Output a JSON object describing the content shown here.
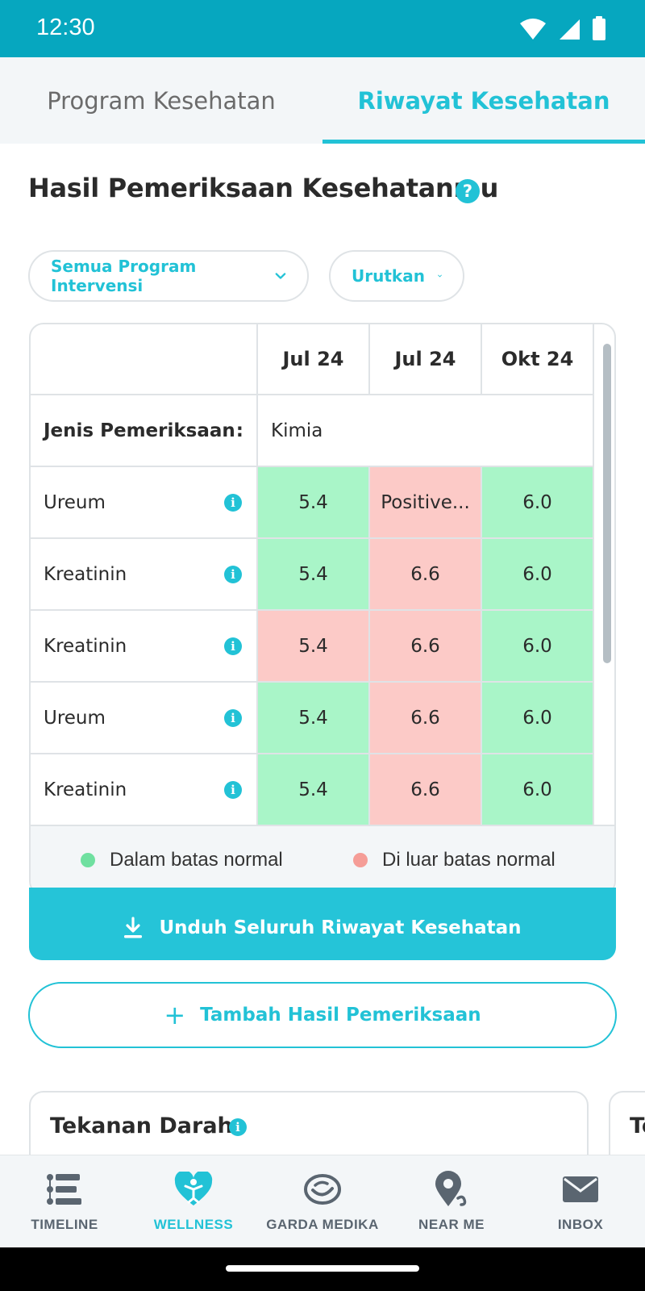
{
  "status_bar": {
    "time": "12:30"
  },
  "tabs": [
    {
      "label": "Program Kesehatan",
      "active": false
    },
    {
      "label": "Riwayat Kesehatan",
      "active": true
    }
  ],
  "section": {
    "title": "Hasil Pemeriksaan Kesehatanmu",
    "help_icon": "?"
  },
  "filters": {
    "program": "Semua Program Intervensi",
    "sort": "Urutkan"
  },
  "table": {
    "columns": [
      "Jul 24",
      "Jul 24",
      "Okt 24"
    ],
    "type_label": "Jenis Pemeriksaan",
    "type_separator": ":",
    "type_value": "Kimia",
    "rows": [
      {
        "name": "Ureum",
        "values": [
          "5.4",
          "Positive...",
          "6.0"
        ],
        "status": [
          "normal",
          "abnormal",
          "normal"
        ]
      },
      {
        "name": "Kreatinin",
        "values": [
          "5.4",
          "6.6",
          "6.0"
        ],
        "status": [
          "normal",
          "abnormal",
          "normal"
        ]
      },
      {
        "name": "Kreatinin",
        "values": [
          "5.4",
          "6.6",
          "6.0"
        ],
        "status": [
          "abnormal",
          "abnormal",
          "normal"
        ]
      },
      {
        "name": "Ureum",
        "values": [
          "5.4",
          "6.6",
          "6.0"
        ],
        "status": [
          "normal",
          "abnormal",
          "normal"
        ]
      },
      {
        "name": "Kreatinin",
        "values": [
          "5.4",
          "6.6",
          "6.0"
        ],
        "status": [
          "normal",
          "abnormal",
          "normal"
        ]
      }
    ],
    "info_glyph": "i"
  },
  "legend": {
    "normal": "Dalam batas normal",
    "abnormal": "Di luar batas normal"
  },
  "buttons": {
    "download": "Unduh Seluruh Riwayat Kesehatan",
    "add": "Tambah Hasil Pemeriksaan",
    "add_glyph": "+"
  },
  "cards": {
    "blood_pressure": "Tekanan Darah",
    "next_partial": "Te"
  },
  "bottom_nav": [
    {
      "label": "TIMELINE",
      "icon": "timeline-icon",
      "active": false
    },
    {
      "label": "WELLNESS",
      "icon": "wellness-heart-icon",
      "active": true
    },
    {
      "label": "GARDA MEDIKA",
      "icon": "garda-medika-icon",
      "active": false
    },
    {
      "label": "NEAR ME",
      "icon": "location-pin-icon",
      "active": false
    },
    {
      "label": "INBOX",
      "icon": "envelope-icon",
      "active": false
    }
  ],
  "colors": {
    "primary": "#22c2d6",
    "status_bar": "#06a7bf",
    "normal": "#a9f5c8",
    "abnormal": "#fccac7",
    "legend_normal_dot": "#6fe0a0",
    "legend_abnormal_dot": "#f59d97"
  }
}
